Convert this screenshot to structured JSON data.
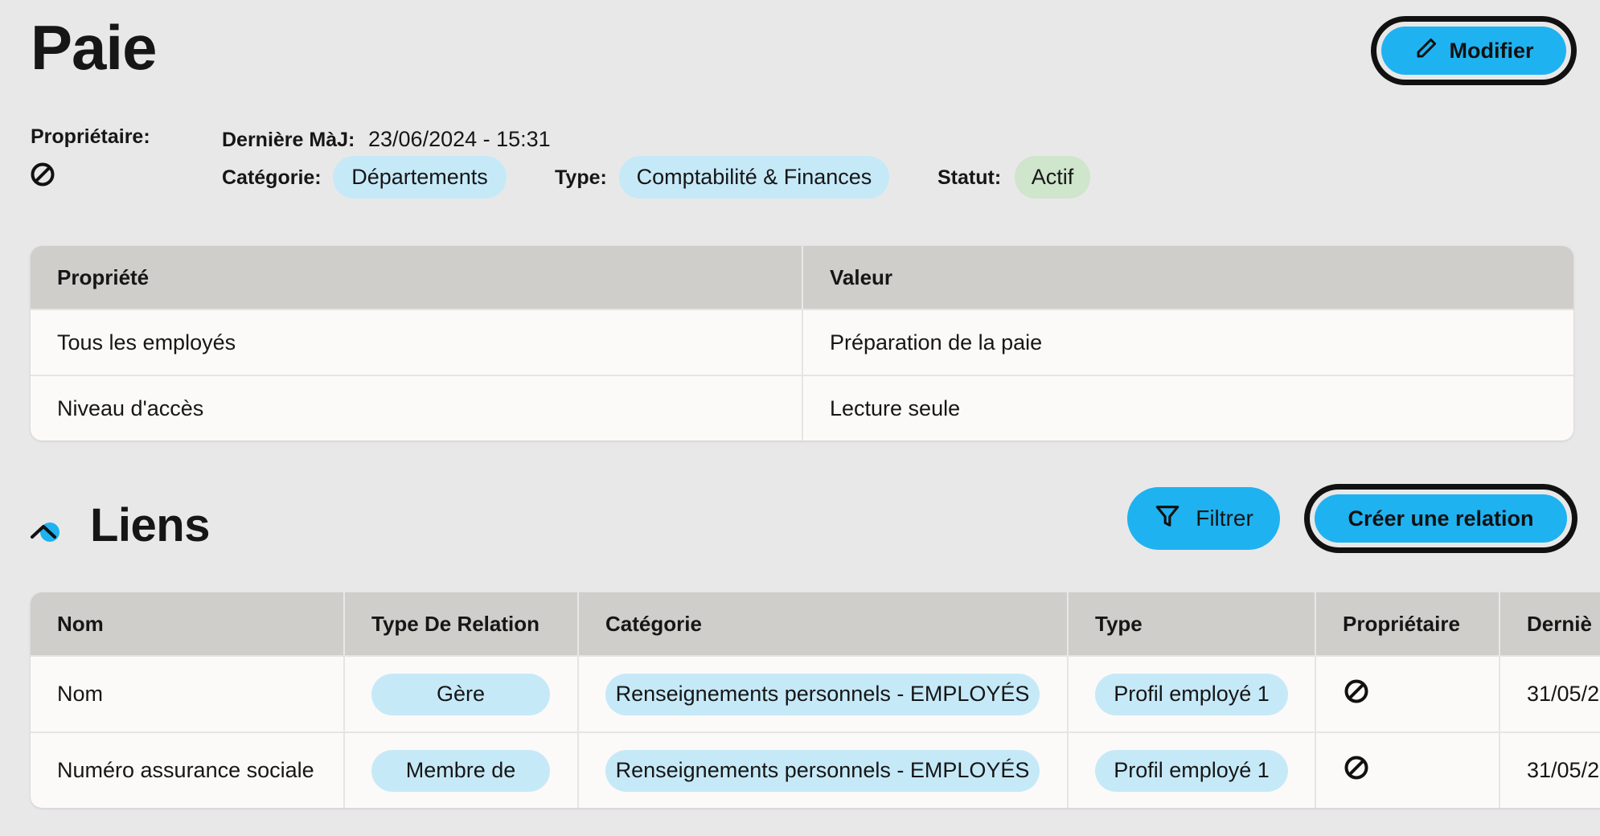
{
  "page": {
    "title": "Paie",
    "edit_label": "Modifier"
  },
  "meta": {
    "owner_label": "Propriétaire:",
    "owner_icon": "no-owner-icon",
    "last_update_label": "Dernière MàJ:",
    "last_update_value": "23/06/2024 - 15:31",
    "category_label": "Catégorie:",
    "category_value": "Départements",
    "type_label": "Type:",
    "type_value": "Comptabilité & Finances",
    "status_label": "Statut:",
    "status_value": "Actif"
  },
  "properties": {
    "headers": [
      "Propriété",
      "Valeur"
    ],
    "rows": [
      [
        "Tous les employés",
        "Préparation de la paie"
      ],
      [
        "Niveau d'accès",
        "Lecture seule"
      ]
    ]
  },
  "links": {
    "title": "Liens",
    "filter_label": "Filtrer",
    "create_label": "Créer une relation",
    "headers": [
      "Nom",
      "Type De Relation",
      "Catégorie",
      "Type",
      "Propriétaire",
      "Derniè"
    ],
    "rows": [
      [
        "Nom",
        "Gère",
        "Renseignements personnels - EMPLOYÉS",
        "Profil employé 1",
        "",
        "31/05/2"
      ],
      [
        "Numéro assurance sociale",
        "Membre de",
        "Renseignements personnels - EMPLOYÉS",
        "Profil employé 1",
        "",
        "31/05/2"
      ]
    ]
  },
  "colors": {
    "accent": "#1fb2f0",
    "chip_blue": "#c6e9f8",
    "chip_green": "#cfe5cc",
    "header_gray": "#cfceca",
    "background": "#e9e8e9"
  }
}
